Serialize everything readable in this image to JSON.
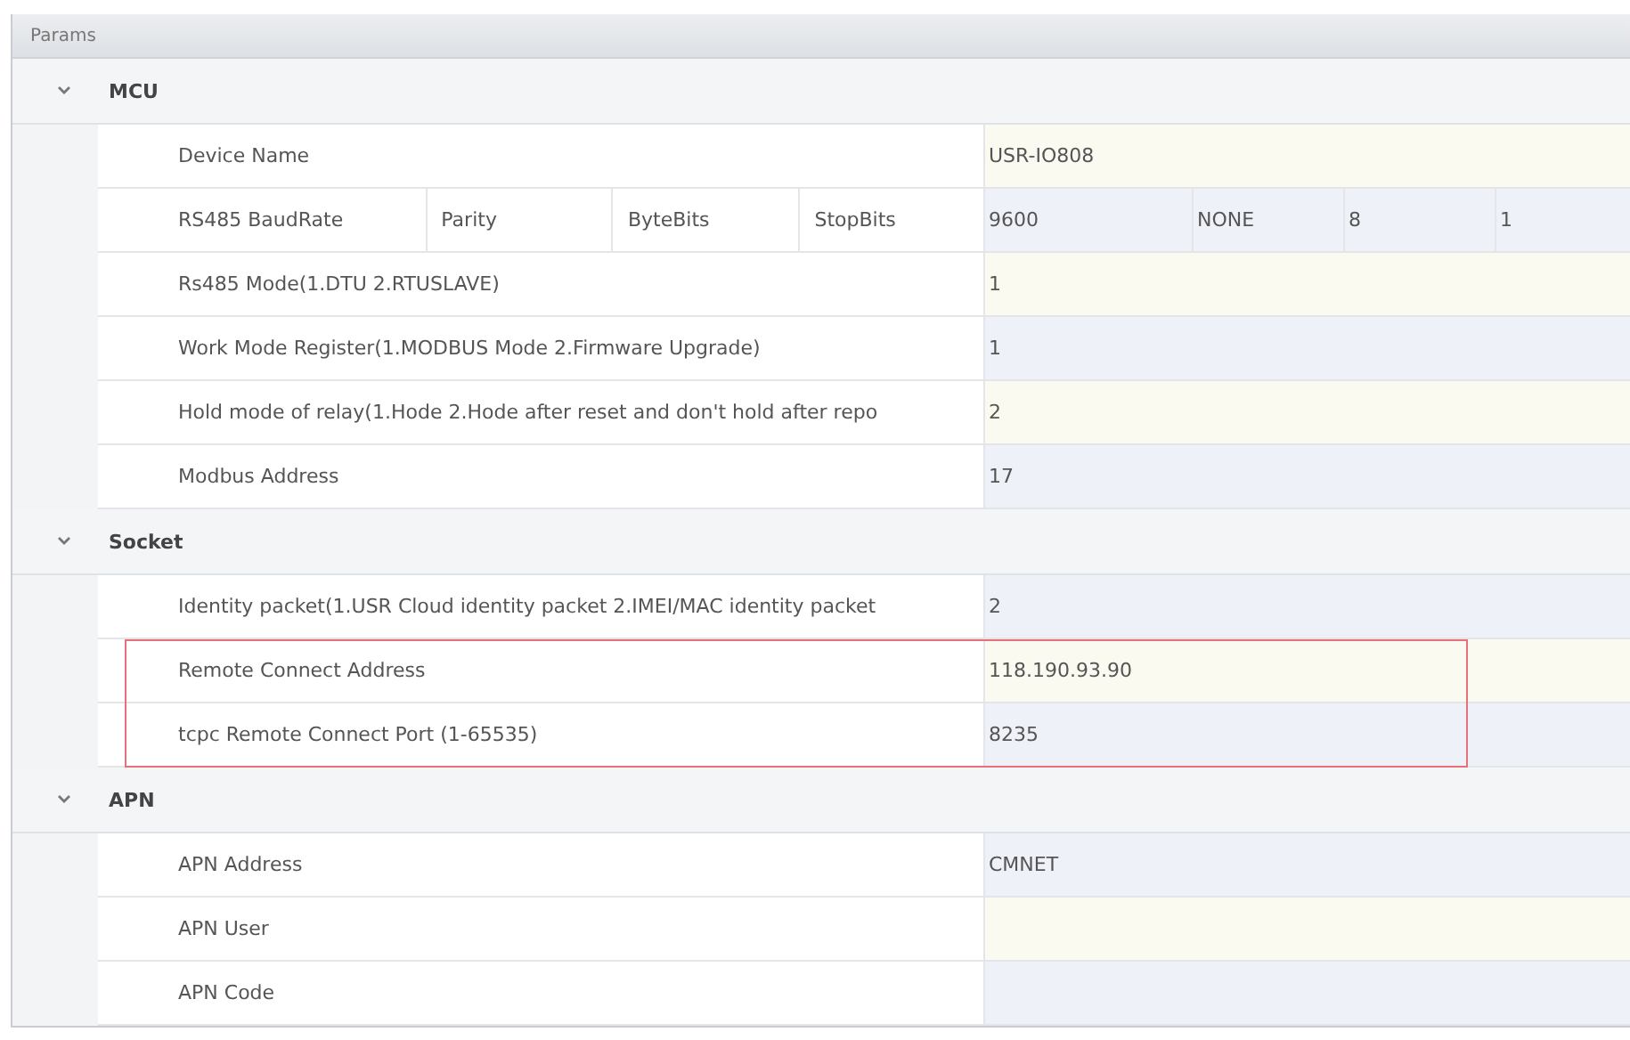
{
  "panel": {
    "title": "Params"
  },
  "groups": [
    {
      "name": "MCU",
      "expanded": true,
      "rows": [
        {
          "kind": "single",
          "label": "Device Name",
          "value": "USR-IO808"
        },
        {
          "kind": "multi",
          "labels": [
            "RS485 BaudRate",
            "Parity",
            "ByteBits",
            "StopBits"
          ],
          "values": [
            "9600",
            "NONE",
            "8",
            "1"
          ]
        },
        {
          "kind": "single",
          "label": "Rs485 Mode(1.DTU 2.RTUSLAVE)",
          "value": "1"
        },
        {
          "kind": "single",
          "label": "Work Mode Register(1.MODBUS Mode 2.Firmware Upgrade)",
          "value": "1"
        },
        {
          "kind": "single",
          "label": "Hold mode of relay(1.Hode 2.Hode after reset and don't hold after repo",
          "value": "2"
        },
        {
          "kind": "single",
          "label": "Modbus Address",
          "value": "17"
        }
      ]
    },
    {
      "name": "Socket",
      "expanded": true,
      "rows": [
        {
          "kind": "single",
          "label": "Identity packet(1.USR Cloud identity packet 2.IMEI/MAC identity packet",
          "value": "2"
        },
        {
          "kind": "single",
          "label": "Remote Connect Address",
          "value": "118.190.93.90",
          "highlighted": true
        },
        {
          "kind": "single",
          "label": "tcpc Remote Connect Port (1-65535)",
          "value": "8235",
          "highlighted": true
        }
      ]
    },
    {
      "name": "APN",
      "expanded": true,
      "rows": [
        {
          "kind": "single",
          "label": "APN Address",
          "value": "CMNET"
        },
        {
          "kind": "single",
          "label": "APN User"
        },
        {
          "kind": "single",
          "label": "APN Code"
        }
      ]
    }
  ]
}
